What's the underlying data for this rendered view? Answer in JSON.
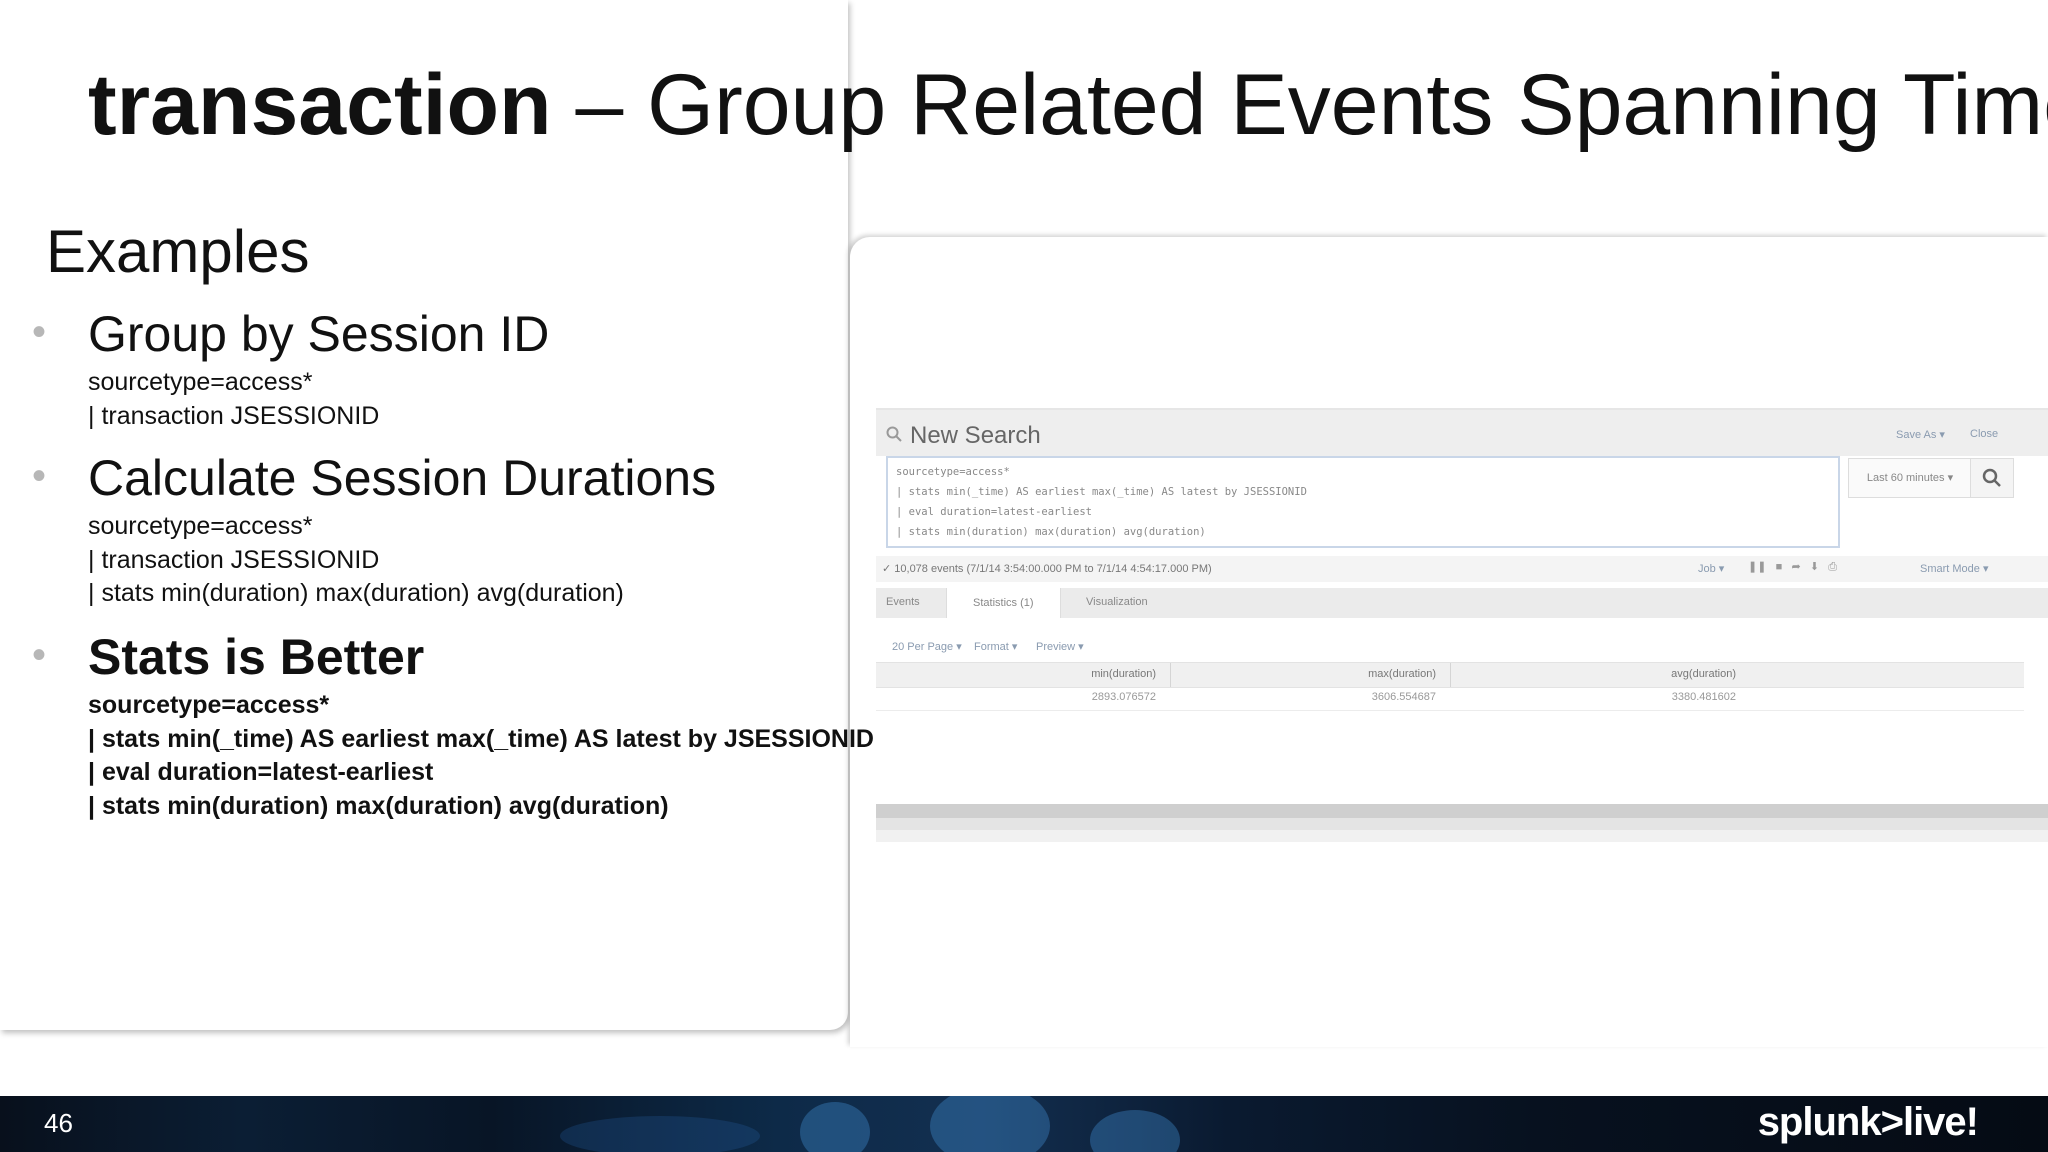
{
  "title": {
    "command": "transaction",
    "rest": " – Group Related Events Spanning Time"
  },
  "examples_label": "Examples",
  "sections": [
    {
      "heading": "Group by Session ID",
      "code": [
        "sourcetype=access*",
        "| transaction JSESSIONID"
      ]
    },
    {
      "heading": "Calculate Session Durations",
      "code": [
        "sourcetype=access*",
        "| transaction JSESSIONID",
        "| stats min(duration) max(duration) avg(duration)"
      ]
    },
    {
      "heading": "Stats is Better",
      "code": [
        "sourcetype=access*",
        "| stats min(_time) AS earliest max(_time) AS latest by JSESSIONID",
        "| eval duration=latest-earliest",
        "| stats min(duration) max(duration) avg(duration)"
      ]
    }
  ],
  "screenshot": {
    "title": "New Search",
    "save_as": "Save As ▾",
    "close": "Close",
    "query_lines": [
      "sourcetype=access*",
      "| stats min(_time) AS earliest max(_time) AS latest by JSESSIONID",
      "| eval duration=latest-earliest",
      "| stats min(duration) max(duration) avg(duration)"
    ],
    "time_range": "Last 60 minutes ▾",
    "status": "✓ 10,078 events (7/1/14 3:54:00.000 PM to 7/1/14 4:54:17.000 PM)",
    "job": "Job ▾",
    "mode": "Smart Mode ▾",
    "tabs": [
      "Events",
      "Statistics (1)",
      "Visualization"
    ],
    "options": [
      "20 Per Page ▾",
      "Format ▾",
      "Preview ▾"
    ],
    "columns": [
      "min(duration)",
      "max(duration)",
      "avg(duration)"
    ],
    "row": [
      "2893.076572",
      "3606.554687",
      "3380.481602"
    ]
  },
  "footer": {
    "page_number": "46",
    "brand": "splunk>live!"
  },
  "colors": {
    "bullet": "#b7b7b7",
    "footer_bg": "#0b1e34"
  }
}
